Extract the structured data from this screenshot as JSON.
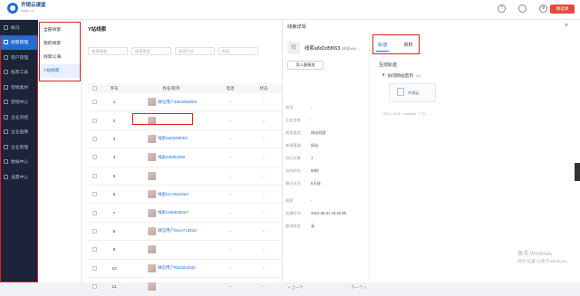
{
  "app": {
    "name_line1": "齐销云课堂",
    "name_line2": "tianjin.cn"
  },
  "topbar": {
    "badge": "精选课"
  },
  "nav": {
    "items": [
      {
        "label": "概况",
        "active": false
      },
      {
        "label": "线索管理",
        "active": true
      },
      {
        "label": "客户管理",
        "active": false
      },
      {
        "label": "拓客工具",
        "active": false
      },
      {
        "label": "营销素材",
        "active": false
      },
      {
        "label": "营销中心",
        "active": false
      },
      {
        "label": "企业风控",
        "active": false
      },
      {
        "label": "企业画像",
        "active": false
      },
      {
        "label": "企业管理",
        "active": false
      },
      {
        "label": "数据中心",
        "active": false
      },
      {
        "label": "设置中心",
        "active": false
      }
    ]
  },
  "subnav": {
    "items": [
      {
        "label": "全部线索",
        "active": false
      },
      {
        "label": "我的线索",
        "active": false
      },
      {
        "label": "线索公海",
        "active": false
      },
      {
        "label": "Y站线索",
        "active": true
      }
    ]
  },
  "main": {
    "title": "Y站线索",
    "filters": [
      "来源渠道",
      "线索类型",
      "留资方式",
      "时间"
    ],
    "columns": {
      "index": "序号",
      "name": "姓名/昵称",
      "phone": "电话",
      "status": "状态"
    },
    "rows": [
      {
        "index": "1",
        "name": "微信用户3383d5d606",
        "phone": "-",
        "status": "-"
      },
      {
        "index": "2",
        "name": "",
        "phone": "-",
        "status": "-"
      },
      {
        "index": "3",
        "name": "线索a8d2d5f063",
        "phone": "-",
        "status": "-"
      },
      {
        "index": "4",
        "name": "线索a85f52060",
        "phone": "-",
        "status": "-"
      },
      {
        "index": "5",
        "name": "",
        "phone": "-",
        "status": "-"
      },
      {
        "index": "6",
        "name": "线索b1c30ee4ed",
        "phone": "-",
        "status": "-"
      },
      {
        "index": "7",
        "name": "线索c666b363e7",
        "phone": "-",
        "status": "-"
      },
      {
        "index": "8",
        "name": "微信用户02ce713810",
        "phone": "-",
        "status": "-"
      },
      {
        "index": "9",
        "name": "",
        "phone": "-",
        "status": "-"
      },
      {
        "index": "10",
        "name": "微信用户f92a2b43d2",
        "phone": "-",
        "status": "-"
      },
      {
        "index": "11",
        "name": "",
        "phone": "-",
        "status": "-"
      }
    ]
  },
  "panel": {
    "title": "线索详情",
    "close": "×",
    "avatar_char": "线",
    "lead_name": "线索a8d2d5f063",
    "lead_sub": "(线索a8d...",
    "import_button": "导入客服池",
    "fields": [
      {
        "k": "电话",
        "v": "-",
        "blue": false
      },
      {
        "k": "企业名称",
        "v": "-",
        "blue": false
      },
      {
        "k": "线索类型",
        "v": "网站线索",
        "blue": false
      },
      {
        "k": "来源渠道",
        "v": "网站",
        "blue": false
      },
      {
        "k": "访问次数",
        "v": "1",
        "blue": false
      },
      {
        "k": "访问时长",
        "v": "88秒",
        "blue": false
      },
      {
        "k": "最近访问",
        "v": "5天前",
        "blue": false
      },
      {
        "k": "线索",
        "v": "-",
        "blue": false
      },
      {
        "k": "创建时间",
        "v": "2022-05-31 16:20:08",
        "blue": false
      },
      {
        "k": "跟进状态",
        "v": "无",
        "blue": false
      }
    ],
    "prev": "< 上一个",
    "next": "下一个 >",
    "tabs": [
      {
        "label": "轨迹",
        "active": true
      },
      {
        "label": "资料",
        "active": false
      }
    ],
    "section": "互动轨迹",
    "timeline_head": "访问网站首页",
    "timeline_count": "(6)",
    "card_text": "齐销云",
    "meta": "05-31 16:20 · windows · 广州"
  },
  "watermark": {
    "line1": "激活 Windows",
    "line2": "转到\"设置\"以激活 Windows。"
  }
}
